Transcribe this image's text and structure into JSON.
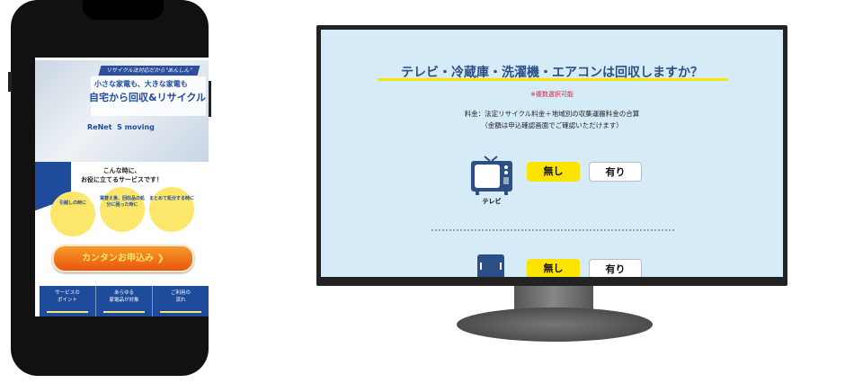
{
  "phone": {
    "hero": {
      "tagline": "リサイクル法対応だから\"あんしん\"",
      "headline1": "小さな家電も、大きな家電も",
      "headline2": "自宅から回収&リサイクル",
      "logo1": "ReNet",
      "logo2": "S moving"
    },
    "section": {
      "title1": "こんな時に、",
      "title2": "お役に立てるサービスです！",
      "circles": [
        "引越しの時に",
        "買替え後、回収品の処分に困った時に",
        "まとめて処分する時に"
      ]
    },
    "cta_label": "カンタンお申込み ❯",
    "nav": [
      {
        "l1": "サービスの",
        "l2": "ポイント"
      },
      {
        "l1": "あらゆる",
        "l2": "家電品が対象"
      },
      {
        "l1": "ご利用の",
        "l2": "流れ"
      }
    ]
  },
  "monitor": {
    "title": "テレビ・冷蔵庫・洗濯機・エアコンは回収しますか？",
    "note": "※複数選択可能",
    "fee_line1": "料金：法定リサイクル料金＋地域別の収集運搬料金の合算",
    "fee_line2": "（金額は申込確認画面でご確認いただけます）",
    "items": [
      {
        "label": "テレビ",
        "no": "無し",
        "yes": "有り",
        "selected": "無し"
      },
      {
        "label": "",
        "no": "無し",
        "yes": "有り",
        "selected": "無し"
      }
    ]
  }
}
